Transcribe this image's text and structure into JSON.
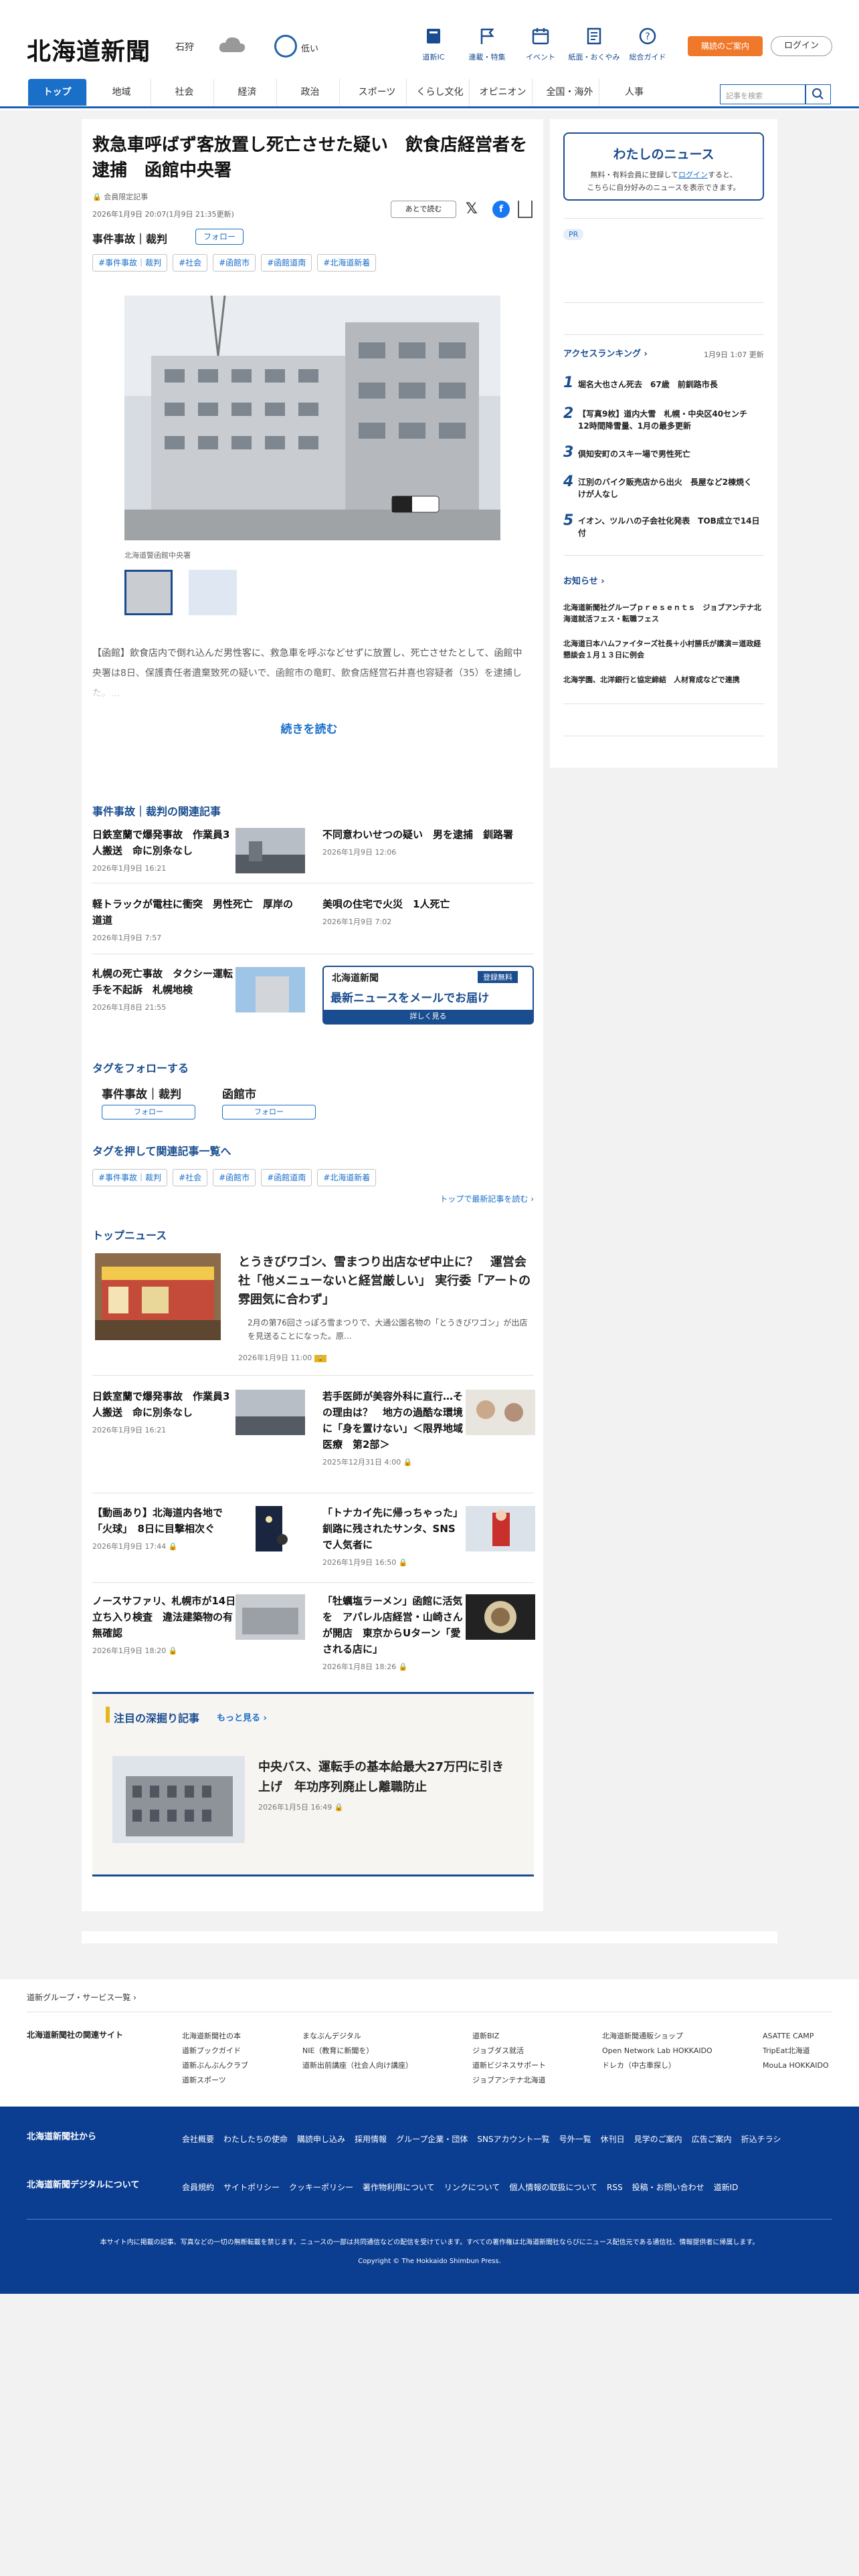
{
  "header": {
    "logo": "北海道新聞",
    "region": "石狩",
    "eco_label": "低い",
    "icons": [
      {
        "label": "道新IC",
        "icon": "book-icon"
      },
      {
        "label": "連載・特集",
        "icon": "flag-icon"
      },
      {
        "label": "イベント",
        "icon": "calendar-icon"
      },
      {
        "label": "紙面・おくやみ",
        "icon": "newspaper-icon"
      },
      {
        "label": "総合ガイド",
        "icon": "help-icon"
      }
    ],
    "subscribe": "購読のご案内",
    "login": "ログイン"
  },
  "nav": {
    "items": [
      "トップ",
      "地域",
      "社会",
      "経済",
      "政治",
      "スポーツ",
      "くらし文化",
      "オピニオン",
      "全国・海外",
      "人事"
    ],
    "search_placeholder": "記事を検索"
  },
  "article": {
    "title": "救急車呼ばず客放置し死亡させた疑い　飲食店経営者を逮捕　函館中央署",
    "label": "会員限定記事",
    "date": "2026年1月9日 20:07(1月9日 21:35更新)",
    "later": "あとで読む",
    "category": "事件事故｜裁判",
    "follow": "フォロー",
    "tags": [
      "#事件事故｜裁判",
      "#社会",
      "#函館市",
      "#函館道南",
      "#北海道新着"
    ],
    "caption": "北海道警函館中央署",
    "lead": "【函館】飲食店内で倒れ込んだ男性客に、救急車を呼ぶなどせずに放置し、死亡させたとして、函館中央署は8日、保護責任者遺棄致死の疑いで、函館市の竜町、飲食店経営石井喜也容疑者（35）を逮捕した。...",
    "read_more": "続きを読む"
  },
  "related": {
    "heading": "事件事故｜裁判の関連記事",
    "items": [
      {
        "title": "日鉄室蘭で爆発事故　作業員3人搬送　命に別条なし",
        "date": "2026年1月9日 16:21"
      },
      {
        "title": "不同意わいせつの疑い　男を逮捕　釧路署",
        "date": "2026年1月9日 12:06"
      },
      {
        "title": "軽トラックが電柱に衝突　男性死亡　厚岸の道道",
        "date": "2026年1月9日 7:57"
      },
      {
        "title": "美唄の住宅で火災　1人死亡",
        "date": "2026年1月9日 7:02"
      },
      {
        "title": "札幌の死亡事故　タクシー運転手を不起訴　札幌地検",
        "date": "2026年1月8日 21:55"
      }
    ],
    "banner_logo": "北海道新聞",
    "banner_free": "登録無料",
    "banner_main": "最新ニュースをメールでお届け",
    "banner_more": "詳しく見る"
  },
  "follow_tags": {
    "heading": "タグをフォローする",
    "items": [
      "事件事故｜裁判",
      "函館市"
    ],
    "button": "フォロー"
  },
  "tag_list": {
    "heading": "タグを押して関連記事一覧へ",
    "tags": [
      "#事件事故｜裁判",
      "#社会",
      "#函館市",
      "#函館道南",
      "#北海道新着"
    ],
    "more": "トップで最新記事を読む"
  },
  "top_news": {
    "heading": "トップニュース",
    "lead_title": "とうきびワゴン、雪まつり出店なぜ中止に？　運営会社「他メニューないと経営厳しい」 実行委「アートの雰囲気に合わず」",
    "lead_text": "2月の第76回さっぽろ雪まつりで、大通公園名物の「とうきびワゴン」が出店を見送ることになった。原...",
    "lead_date": "2026年1月9日 11:00",
    "items": [
      {
        "title": "日鉄室蘭で爆発事故　作業員3人搬送　命に別条なし",
        "date": "2026年1月9日 16:21"
      },
      {
        "title": "若手医師が美容外科に直行…その理由は？　地方の過酷な環境に「身を置けない」＜限界地域医療　第2部＞",
        "date": "2025年12月31日 4:00"
      },
      {
        "title": "【動画あり】北海道内各地で「火球」　8日に目撃相次ぐ",
        "date": "2026年1月9日 17:44"
      },
      {
        "title": "「トナカイ先に帰っちゃった」 釧路に残されたサンタ、SNSで人気者に",
        "date": "2026年1月9日 16:50"
      },
      {
        "title": "ノースサファリ、札幌市が14日立ち入り検査　違法建築物の有無確認",
        "date": "2026年1月9日 18:20"
      },
      {
        "title": "「牡蠣塩ラーメン」函館に活気を　アパレル店経営・山崎さんが開店　東京からUターン「愛される店に」",
        "date": "2026年1月8日 18:26"
      }
    ]
  },
  "deep": {
    "heading": "注目の深掘り記事",
    "more": "もっと見る",
    "title": "中央バス、運転手の基本給最大27万円に引き上げ　年功序列廃止し離職防止",
    "date": "2026年1月5日 16:49"
  },
  "sidebar": {
    "mynews_title": "わたしのニュース",
    "mynews_text1": "無料・有料会員に登録して",
    "mynews_login": "ログイン",
    "mynews_text2": "すると、",
    "mynews_text3": "こちらに自分好みのニュースを表示できます。",
    "pr": "PR",
    "ranking_heading": "アクセスランキング",
    "ranking_updated": "1月9日 1:07 更新",
    "ranking": [
      "堀名大也さん死去　67歳　前釧路市長",
      "【写真9枚】道内大雪　札幌・中央区40センチ　12時間降雪量、1月の最多更新",
      "倶知安町のスキー場で男性死亡",
      "江別のバイク販売店から出火　長屋など2棟焼く　けが人なし",
      "イオン、ツルハの子会社化発表　TOB成立で14日付"
    ],
    "notice_heading": "お知らせ",
    "notices": [
      "北海道新聞社グループｐｒｅｓｅｎｔｓ　ジョブアンテナ北海道就活フェス・転職フェス",
      "北海道日本ハムファイターズ社長＋小村勝氏が講演＝道政経懇談会１月１３日に例会",
      "北海学園、北洋銀行と協定締結　人材育成などで連携"
    ]
  },
  "footer": {
    "group_link": "道新グループ・サービス一覧",
    "related_sites_label": "北海道新聞社の関連サイト",
    "sites": [
      [
        "北海道新聞社の本",
        "道新プックガイド",
        "道新ぶんぶんクラブ",
        "道新スポーツ"
      ],
      [
        "まなぶんデジタル",
        "NIE（教育に新聞を）",
        "道新出前講座（社会人向け講座）"
      ],
      [
        "道新BIZ",
        "ジョブダス就活",
        "道新ビジネスサポート",
        "ジョブアンテナ北海道"
      ],
      [
        "北海道新聞通販ショップ",
        "Open Network Lab HOKKAIDO",
        "ドレカ（中古車探し）"
      ],
      [
        "ASATTE CAMP",
        "TripEat北海道",
        "MouLa HOKKAIDO"
      ]
    ],
    "company_label": "北海道新聞社から",
    "company_links": [
      "会社概要",
      "わたしたちの使命",
      "購読申し込み",
      "採用情報",
      "グループ企業・団体",
      "SNSアカウント一覧",
      "号外一覧",
      "休刊日",
      "見学のご案内",
      "広告ご案内",
      "折込チラシ"
    ],
    "digital_label": "北海道新聞デジタルについて",
    "digital_links": [
      "会員規約",
      "サイトポリシー",
      "クッキーポリシー",
      "著作物利用について",
      "リンクについて",
      "個人情報の取扱について",
      "RSS",
      "投稿・お問い合わせ",
      "道新ID"
    ],
    "notice": "本サイト内に掲載の記事、写真などの一切の無断転載を禁じます。ニュースの一部は共同通信などの配信を受けています。すべての著作権は北海道新聞社ならびにニュース配信元である通信社、情報提供者に帰属します。",
    "copyright": "Copyright © The Hokkaido Shimbun Press."
  }
}
